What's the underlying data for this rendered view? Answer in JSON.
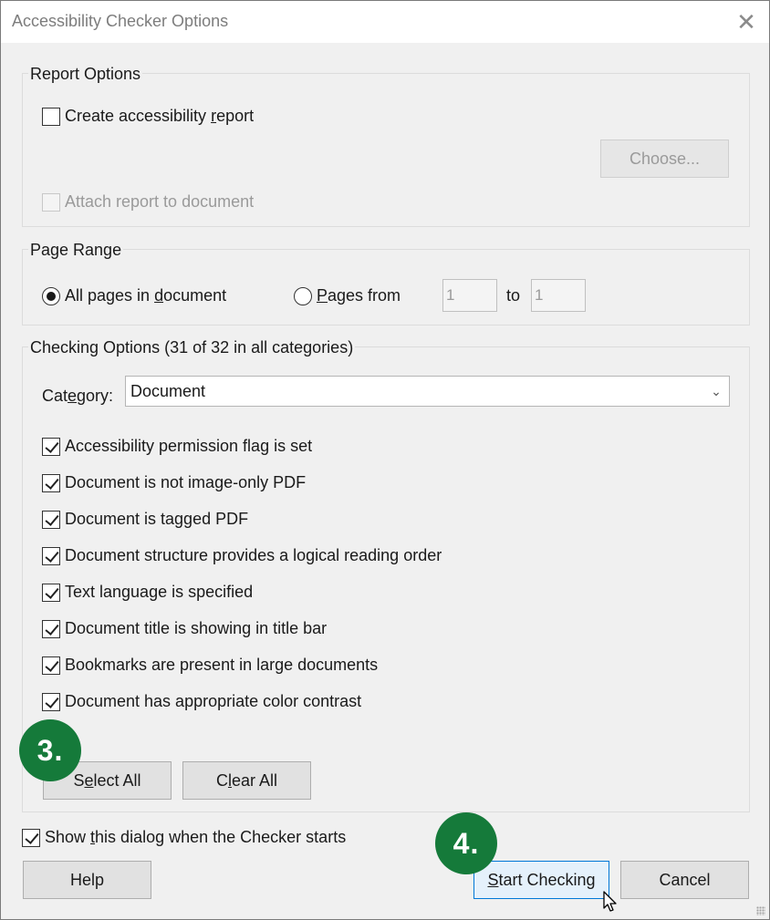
{
  "window": {
    "title": "Accessibility Checker Options",
    "close_glyph": "✕"
  },
  "report_options": {
    "group_label": "Report Options",
    "create_report": {
      "label_pre": "Create accessibility ",
      "label_u": "r",
      "label_post": "eport",
      "checked": false
    },
    "choose_button": "Choose...",
    "attach_report": {
      "label": "Attach report to document",
      "checked": false,
      "disabled": true
    }
  },
  "page_range": {
    "group_label": "Page Range",
    "all_pages": {
      "label_pre": "All pages in ",
      "label_u": "d",
      "label_post": "ocument",
      "selected": true
    },
    "pages_from": {
      "label_pre": "",
      "label_u": "P",
      "label_post": "ages from",
      "selected": false
    },
    "from_value": "1",
    "to_label": "to",
    "to_value": "1"
  },
  "checking_options": {
    "group_label": "Checking Options (31 of 32 in all categories)",
    "category_label_pre": "Cat",
    "category_label_u": "e",
    "category_label_post": "gory:",
    "category_value": "Document",
    "items": [
      {
        "label": "Accessibility permission flag is set",
        "checked": true
      },
      {
        "label": "Document is not image-only PDF",
        "checked": true
      },
      {
        "label": "Document is tagged PDF",
        "checked": true
      },
      {
        "label": "Document structure provides a logical reading order",
        "checked": true
      },
      {
        "label": "Text language is specified",
        "checked": true
      },
      {
        "label": "Document title is showing in title bar",
        "checked": true
      },
      {
        "label": "Bookmarks are present in large documents",
        "checked": true
      },
      {
        "label": "Document has appropriate color contrast",
        "checked": true
      }
    ],
    "select_all": {
      "pre": "S",
      "u": "e",
      "post": "lect All"
    },
    "clear_all": {
      "pre": "C",
      "u": "l",
      "post": "ear All"
    }
  },
  "show_dialog": {
    "label_pre": "Show ",
    "label_u": "t",
    "label_post": "his dialog when the Checker starts",
    "checked": true
  },
  "footer": {
    "help": "Help",
    "start": {
      "pre": "",
      "u": "S",
      "post": "tart Checking"
    },
    "cancel": "Cancel"
  },
  "badges": {
    "step3": "3.",
    "step4": "4."
  },
  "colors": {
    "badge": "#157a3a",
    "default_button_border": "#0078d7"
  }
}
